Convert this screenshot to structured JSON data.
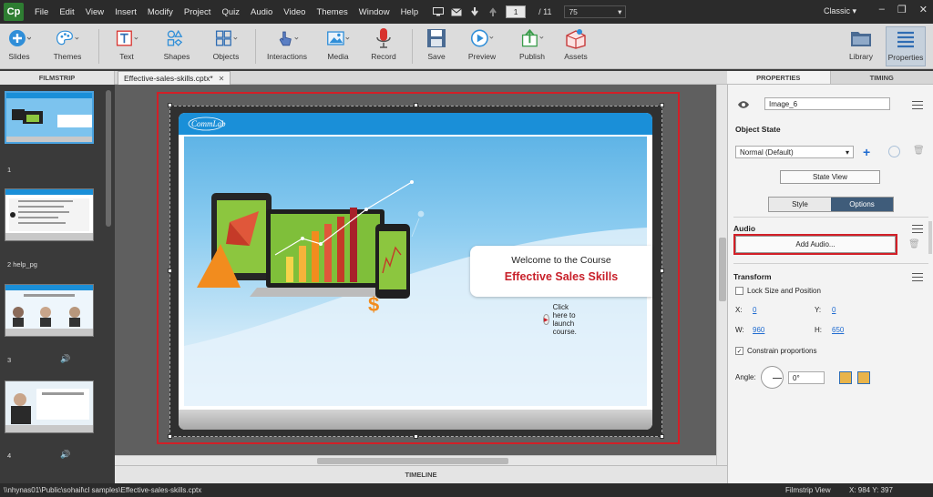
{
  "menubar": {
    "logo": "Cp",
    "items": [
      "File",
      "Edit",
      "View",
      "Insert",
      "Modify",
      "Project",
      "Quiz",
      "Audio",
      "Video",
      "Themes",
      "Window",
      "Help"
    ],
    "current_slide": "1",
    "total_slides": "/ 11",
    "zoom": "75",
    "workspace": "Classic"
  },
  "toolbar": {
    "buttons": [
      {
        "label": "Slides",
        "icon": "slides-icon"
      },
      {
        "label": "Themes",
        "icon": "themes-icon"
      },
      {
        "label": "Text",
        "icon": "text-icon"
      },
      {
        "label": "Shapes",
        "icon": "shapes-icon"
      },
      {
        "label": "Objects",
        "icon": "objects-icon"
      },
      {
        "label": "Interactions",
        "icon": "interactions-icon"
      },
      {
        "label": "Media",
        "icon": "media-icon"
      },
      {
        "label": "Record",
        "icon": "record-icon"
      },
      {
        "label": "Save",
        "icon": "save-icon"
      },
      {
        "label": "Preview",
        "icon": "preview-icon"
      },
      {
        "label": "Publish",
        "icon": "publish-icon"
      },
      {
        "label": "Assets",
        "icon": "assets-icon"
      },
      {
        "label": "Library",
        "icon": "library-icon"
      },
      {
        "label": "Properties",
        "icon": "properties-icon"
      }
    ]
  },
  "filmstrip": {
    "title": "FILMSTRIP",
    "slides": [
      {
        "number": "1",
        "label": "1"
      },
      {
        "number": "2",
        "label": "2 help_pg"
      },
      {
        "number": "3",
        "label": "3"
      },
      {
        "number": "4",
        "label": "4"
      }
    ]
  },
  "document": {
    "tab_title": "Effective-sales-skills.cptx*",
    "timeline": "TIMELINE"
  },
  "slide": {
    "logo_text": "CommLab",
    "welcome": "Welcome to the Course",
    "course_title": "Effective Sales Skills",
    "launch_text": "Click here to launch course."
  },
  "properties": {
    "tabs": [
      "PROPERTIES",
      "TIMING"
    ],
    "object_name": "Image_6",
    "object_state_heading": "Object State",
    "state_value": "Normal (Default)",
    "state_view_button": "State View",
    "style_tab": "Style",
    "options_tab": "Options",
    "audio_heading": "Audio",
    "add_audio_button": "Add Audio...",
    "transform_heading": "Transform",
    "lock_label": "Lock Size and Position",
    "x_label": "X:",
    "x_value": "0",
    "y_label": "Y:",
    "y_value": "0",
    "w_label": "W:",
    "w_value": "960",
    "h_label": "H:",
    "h_value": "650",
    "constrain_label": "Constrain proportions",
    "angle_label": "Angle:",
    "angle_value": "0°"
  },
  "statusbar": {
    "path": "\\\\nhynas01\\Public\\sohail\\cl samples\\Effective-sales-skills.cptx",
    "view": "Filmstrip View",
    "coords": "X: 984 Y: 397"
  },
  "colors": {
    "accent_red": "#d21f27",
    "title_red": "#c8202a",
    "header_blue": "#1a8fd8",
    "options_tab": "#3f5c7a"
  }
}
